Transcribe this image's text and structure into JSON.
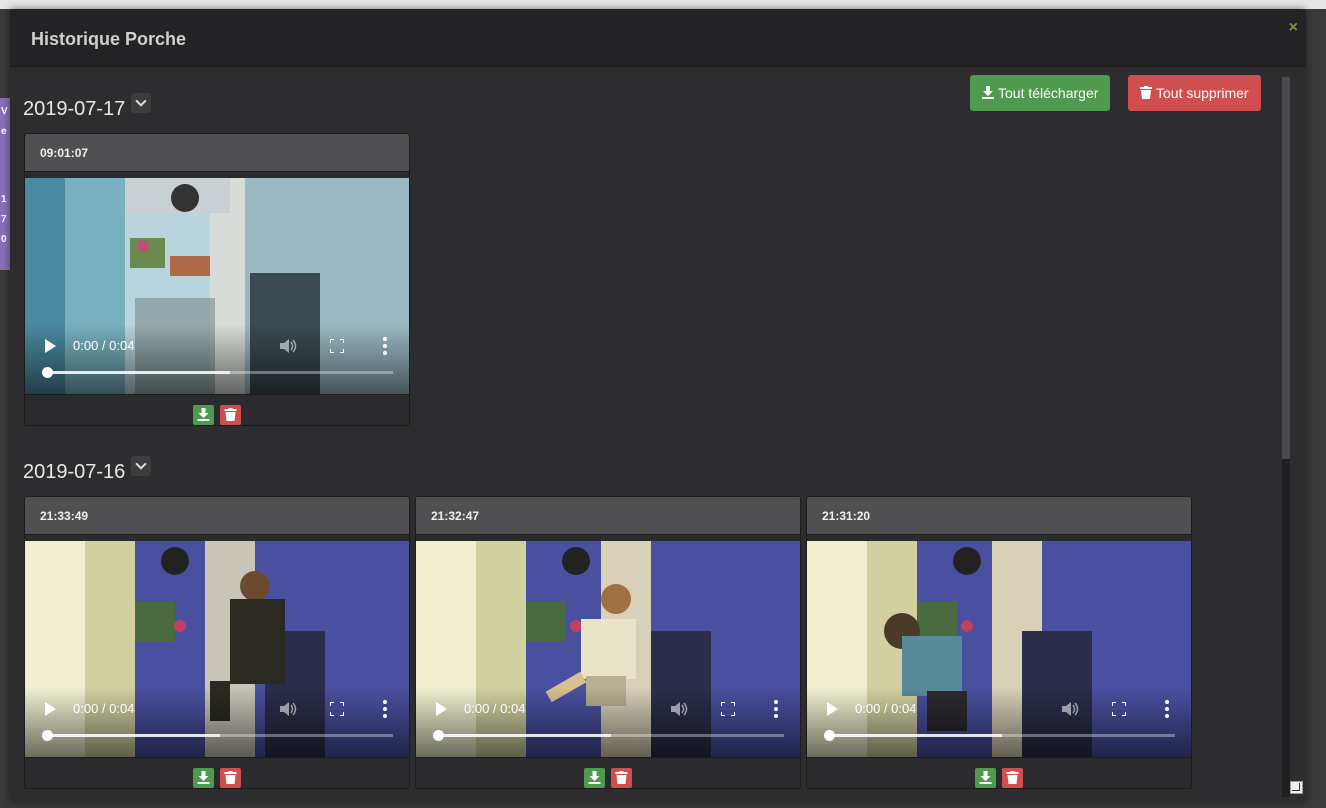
{
  "modal": {
    "title": "Historique Porche",
    "close_icon": "close-icon"
  },
  "actions": {
    "download_all_label": "Tout télécharger",
    "delete_all_label": "Tout supprimer",
    "download_icon": "download-icon",
    "trash_icon": "trash-icon"
  },
  "colors": {
    "success": "#4f9a4f",
    "danger": "#d14e4e",
    "header_bg": "#232325",
    "body_bg": "#2d2d2f"
  },
  "groups": [
    {
      "date": "2019-07-17",
      "clips": [
        {
          "time": "09:01:07",
          "player_time": "0:00 / 0:04",
          "progress_buffered": 0.53
        }
      ]
    },
    {
      "date": "2019-07-16",
      "clips": [
        {
          "time": "21:33:49",
          "player_time": "0:00 / 0:04",
          "progress_buffered": 0.5
        },
        {
          "time": "21:32:47",
          "player_time": "0:00 / 0:04",
          "progress_buffered": 0.5
        },
        {
          "time": "21:31:20",
          "player_time": "0:00 / 0:04",
          "progress_buffered": 0.5
        }
      ]
    }
  ]
}
